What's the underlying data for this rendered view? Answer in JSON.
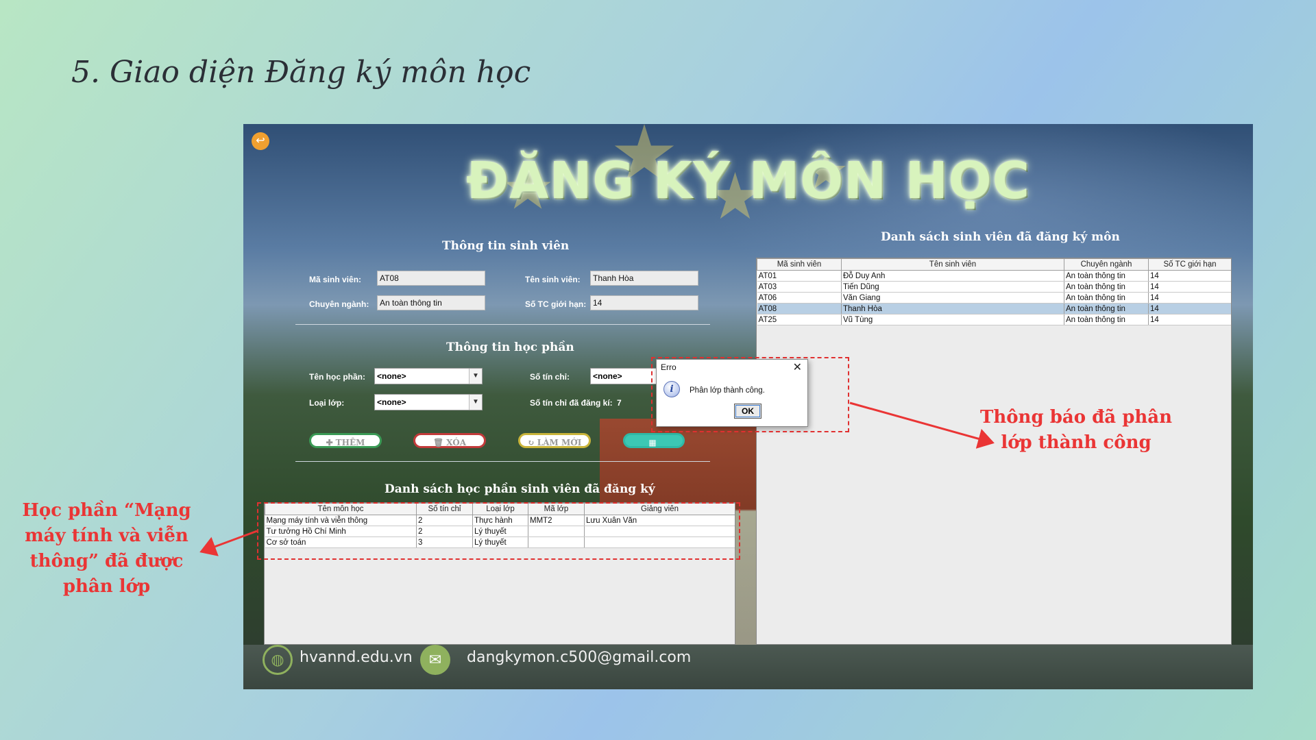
{
  "slide": {
    "title": "5. Giao diện Đăng ký môn học"
  },
  "app": {
    "title": "ĐĂNG KÝ MÔN HỌC",
    "back_icon": "back-arrow-icon",
    "student_info": {
      "heading": "Thông tin sinh viên",
      "ma_sv_label": "Mã sinh viên:",
      "ma_sv_value": "AT08",
      "ten_sv_label": "Tên sinh viên:",
      "ten_sv_value": "Thanh Hòa",
      "chuyen_nganh_label": "Chuyên ngành:",
      "chuyen_nganh_value": "An toàn thông tin",
      "so_tc_label": "Số TC giới hạn:",
      "so_tc_value": "14"
    },
    "course_info": {
      "heading": "Thông tin học phần",
      "ten_hp_label": "Tên học phần:",
      "ten_hp_value": "<none>",
      "so_tin_chi_label": "Số tín chỉ:",
      "so_tin_chi_value": "<none>",
      "loai_lop_label": "Loại lớp:",
      "loai_lop_value": "<none>",
      "so_tc_dk_label": "Số tín chỉ đã đăng kí:",
      "so_tc_dk_value": "7"
    },
    "buttons": {
      "them": "THÊM",
      "xoa": "XÓA",
      "lam_moi": "LÀM MỚI",
      "save": ""
    },
    "registered_courses": {
      "heading": "Danh sách học phần sinh viên đã đăng ký",
      "columns": [
        "Tên môn học",
        "Số tín chỉ",
        "Loại lớp",
        "Mã lớp",
        "Giảng viên"
      ],
      "rows": [
        [
          "Mạng máy tính và viễn thông",
          "2",
          "Thực hành",
          "MMT2",
          "Lưu Xuân Văn"
        ],
        [
          "Tư tưởng Hồ Chí Minh",
          "2",
          "Lý thuyết",
          "",
          ""
        ],
        [
          "Cơ sở toán",
          "3",
          "Lý thuyết",
          "",
          ""
        ]
      ]
    },
    "registered_students": {
      "heading": "Danh sách sinh viên đã đăng ký môn",
      "columns": [
        "Mã sinh viên",
        "Tên sinh viên",
        "Chuyên ngành",
        "Số TC giới hạn"
      ],
      "rows": [
        [
          "AT01",
          "Đỗ Duy Anh",
          "An toàn thông tin",
          "14"
        ],
        [
          "AT03",
          "Tiến Dũng",
          "An toàn thông tin",
          "14"
        ],
        [
          "AT06",
          "Văn Giang",
          "An toàn thông tin",
          "14"
        ],
        [
          "AT08",
          "Thanh Hòa",
          "An toàn thông tin",
          "14"
        ],
        [
          "AT25",
          "Vũ Tùng",
          "An toàn thông tin",
          "14"
        ]
      ],
      "selected_row": 3
    },
    "dialog": {
      "title": "Erro",
      "message": "Phân lớp thành công.",
      "ok": "OK",
      "close": "✕"
    },
    "footer": {
      "website": "hvannd.edu.vn",
      "email": "dangkymon.c500@gmail.com"
    }
  },
  "annotations": {
    "left": "Học phần “Mạng máy tính và viễn thông” đã được phân lớp",
    "right": "Thông báo đã phân lớp thành công"
  },
  "colors": {
    "annotation_red": "#ea3535",
    "selected_row": "#b8cfe4",
    "title_glow": "#d8f3bd"
  }
}
